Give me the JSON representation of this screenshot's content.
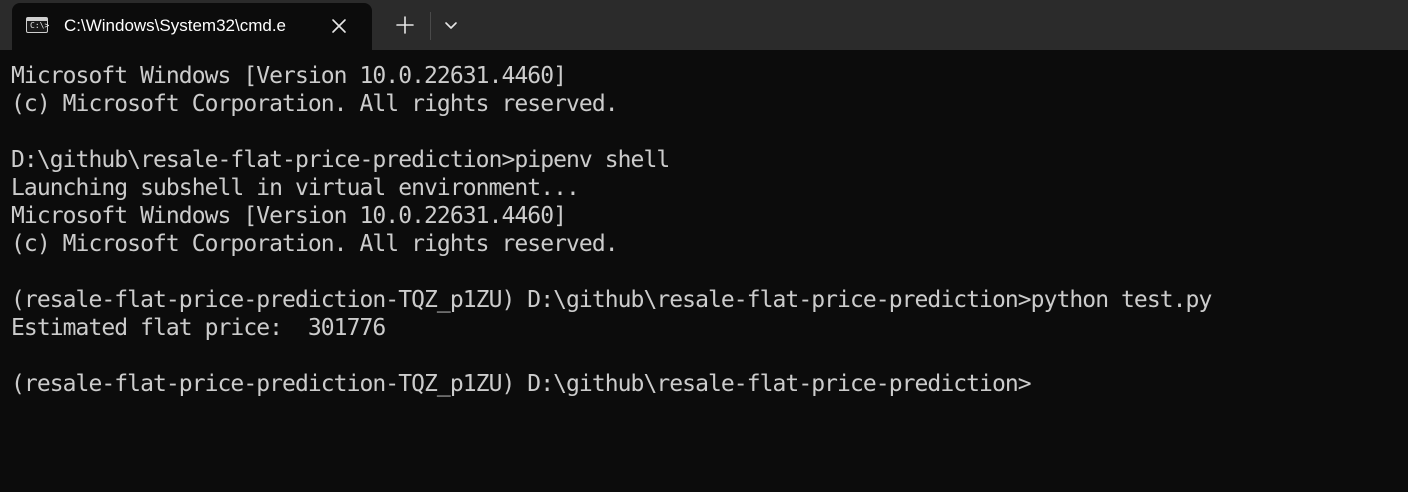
{
  "tab": {
    "title": "C:\\Windows\\System32\\cmd.e",
    "icon": "cmd-prompt-icon",
    "icon_text": "C:\\>"
  },
  "toolbar": {
    "new_tab_icon": "plus-icon",
    "dropdown_icon": "chevron-down-icon"
  },
  "terminal": {
    "text_color": "#cccccc",
    "background": "#0c0c0c",
    "lines": [
      "Microsoft Windows [Version 10.0.22631.4460]",
      "(c) Microsoft Corporation. All rights reserved.",
      "",
      "D:\\github\\resale-flat-price-prediction>pipenv shell",
      "Launching subshell in virtual environment...",
      "Microsoft Windows [Version 10.0.22631.4460]",
      "(c) Microsoft Corporation. All rights reserved.",
      "",
      "(resale-flat-price-prediction-TQZ_p1ZU) D:\\github\\resale-flat-price-prediction>python test.py",
      "Estimated flat price:  301776",
      "",
      "(resale-flat-price-prediction-TQZ_p1ZU) D:\\github\\resale-flat-price-prediction>"
    ]
  }
}
